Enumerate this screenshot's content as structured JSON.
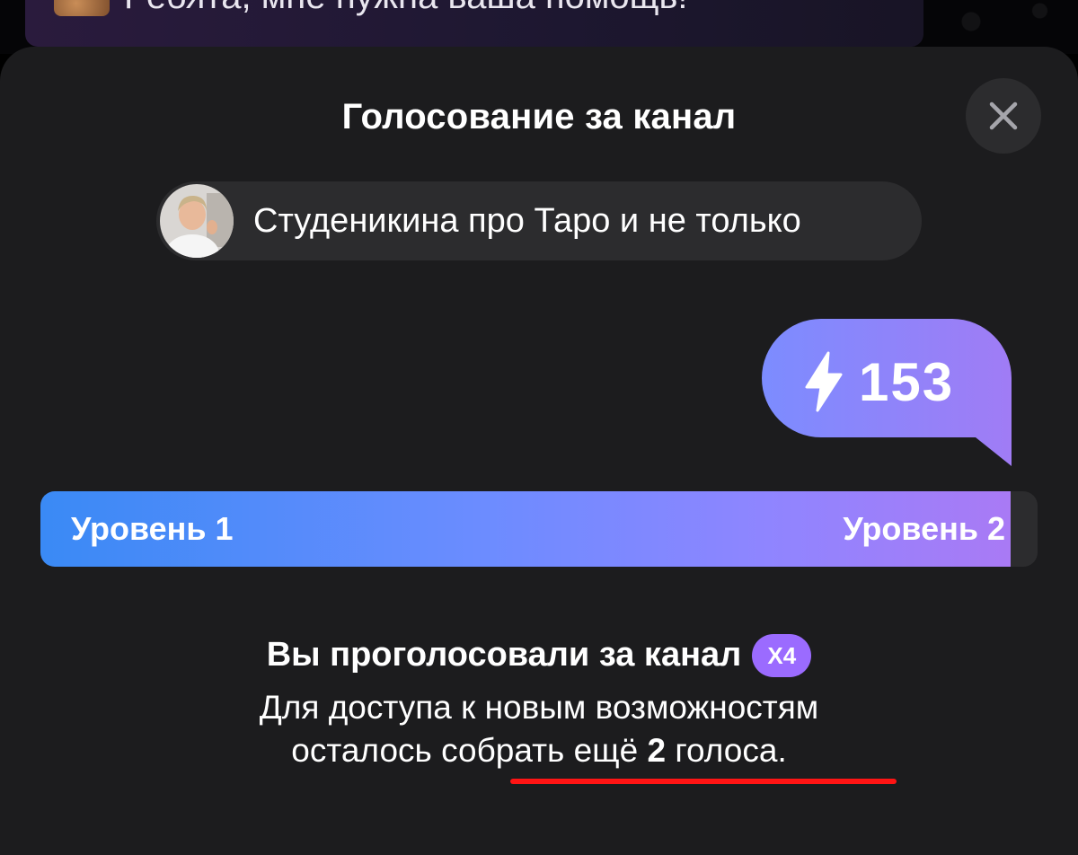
{
  "background_chat": {
    "message_text": "Ребята, мне нужна ваша помощь!"
  },
  "sheet": {
    "title": "Голосование за канал",
    "close_icon": "close-icon"
  },
  "channel": {
    "name": "Студеникина про Таро и не только",
    "avatar": "avatar"
  },
  "boost": {
    "icon": "lightning-icon",
    "count": "153"
  },
  "level": {
    "current_label": "Уровень 1",
    "next_label": "Уровень 2",
    "progress": 0.973,
    "colors": {
      "start": "#3a8af5",
      "end": "#a97af5",
      "track": "#2c2c2e"
    }
  },
  "status": {
    "voted_text": "Вы проголосовали за канал",
    "multiplier": "X4",
    "desc_line1": "Для доступа к новым возможностям",
    "desc_line2_prefix": "осталось собрать ещё ",
    "desc_line2_number": "2",
    "desc_line2_suffix": " голоса."
  },
  "colors": {
    "sheet_bg": "#1c1c1e",
    "chip_bg": "#2c2c2e",
    "badge": "#9b6bff",
    "underline": "#ff1414"
  }
}
